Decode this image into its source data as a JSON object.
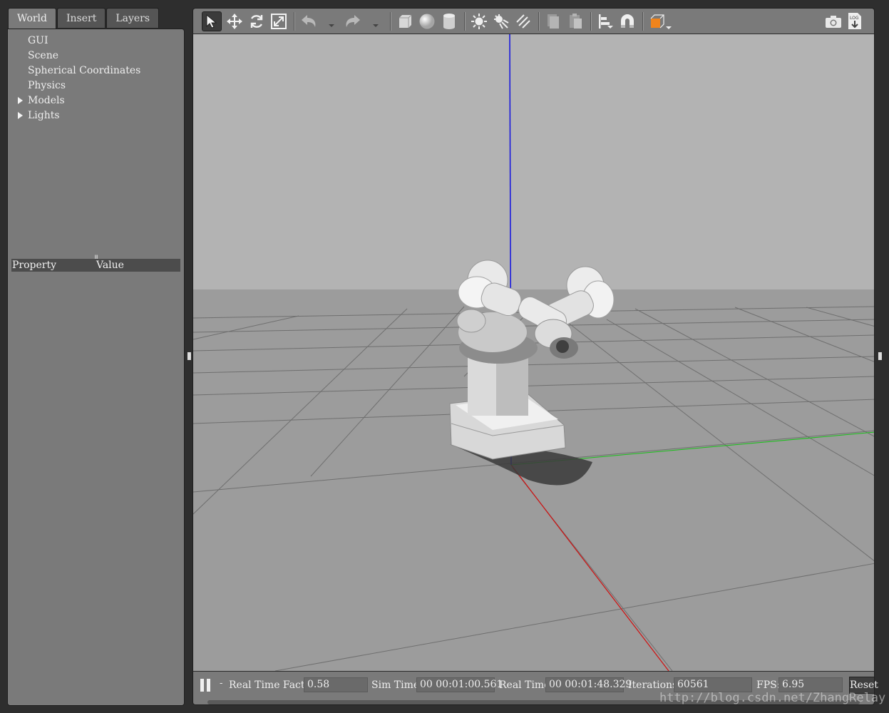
{
  "left_panel": {
    "tabs": [
      {
        "label": "World",
        "active": true
      },
      {
        "label": "Insert",
        "active": false
      },
      {
        "label": "Layers",
        "active": false
      }
    ],
    "tree": [
      {
        "label": "GUI",
        "expandable": false
      },
      {
        "label": "Scene",
        "expandable": false
      },
      {
        "label": "Spherical Coordinates",
        "expandable": false
      },
      {
        "label": "Physics",
        "expandable": false
      },
      {
        "label": "Models",
        "expandable": true
      },
      {
        "label": "Lights",
        "expandable": true
      }
    ],
    "property_header": {
      "col1": "Property",
      "col2": "Value"
    }
  },
  "toolbar": {
    "tools": [
      "select-arrow-icon",
      "translate-icon",
      "rotate-icon",
      "scale-icon",
      "undo-icon",
      "redo-icon",
      "box-icon",
      "sphere-icon",
      "cylinder-icon",
      "point-light-icon",
      "spot-light-icon",
      "directional-light-icon",
      "copy-icon",
      "paste-icon",
      "align-icon",
      "magnet-snap-icon",
      "view-angle-icon",
      "screenshot-camera-icon",
      "log-icon"
    ],
    "active_tool": "select-arrow-icon",
    "accent_color": "#f0841c"
  },
  "viewport": {
    "background_sky": "#b4b4b4",
    "ground_color": "#9c9c9c",
    "axis_colors": {
      "x": "#d01010",
      "y": "#18c018",
      "z": "#1010e0"
    }
  },
  "bottom_bar": {
    "step_label": "-",
    "real_time_factor": {
      "label": "Real Time Factor:",
      "value": "0.58"
    },
    "sim_time": {
      "label": "Sim Time:",
      "value": "00 00:01:00.561"
    },
    "real_time": {
      "label": "Real Time:",
      "value": "00 00:01:48.329"
    },
    "iterations": {
      "label": "Iterations:",
      "value": "60561"
    },
    "fps": {
      "label": "FPS:",
      "value": "6.95"
    },
    "reset_label": "Reset"
  },
  "watermark": "http://blog.csdn.net/ZhangRelay"
}
